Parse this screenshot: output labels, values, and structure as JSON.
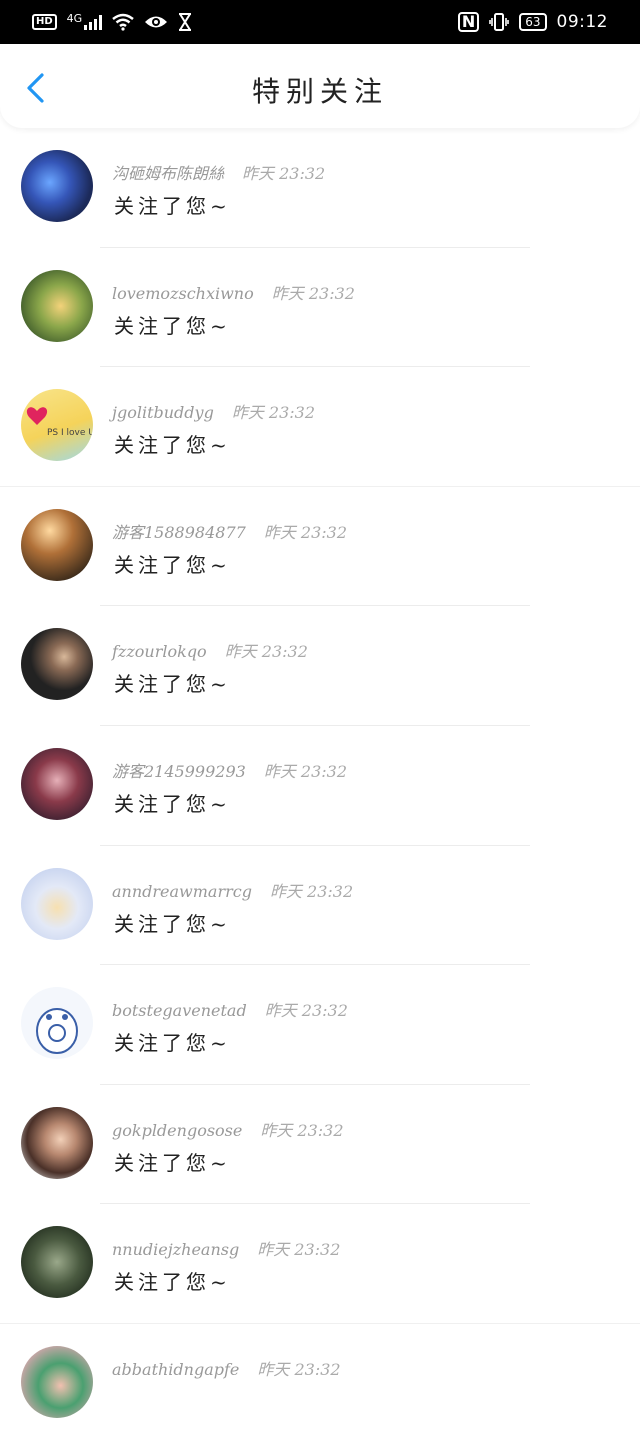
{
  "status_bar": {
    "hd": "HD",
    "network": "4G",
    "battery": "63",
    "time": "09:12"
  },
  "header": {
    "title": "特别关注"
  },
  "items": [
    {
      "name": "沟砸姆布陈朗絲",
      "time": "昨天 23:32",
      "message": "关注了您~",
      "avatar_color": "#2a3f8f"
    },
    {
      "name": "lovemozschxiwno",
      "time": "昨天 23:32",
      "message": "关注了您~",
      "avatar_color": "#6a8a2e"
    },
    {
      "name": "jgolitbuddyg",
      "time": "昨天 23:32",
      "message": "关注了您~",
      "avatar_color": "#f2d36b"
    },
    {
      "name": "游客1588984877",
      "time": "昨天 23:32",
      "message": "关注了您~",
      "avatar_color": "#8a5a2a"
    },
    {
      "name": "fzzourlokqo",
      "time": "昨天 23:32",
      "message": "关注了您~",
      "avatar_color": "#2b2b2b"
    },
    {
      "name": "游客2145999293",
      "time": "昨天 23:32",
      "message": "关注了您~",
      "avatar_color": "#6a3b4a"
    },
    {
      "name": "anndreawmarrcg",
      "time": "昨天 23:32",
      "message": "关注了您~",
      "avatar_color": "#c9d6f0"
    },
    {
      "name": "botstegavenetad",
      "time": "昨天 23:32",
      "message": "关注了您~",
      "avatar_color": "#e9eef8"
    },
    {
      "name": "gokpldengosose",
      "time": "昨天 23:32",
      "message": "关注了您~",
      "avatar_color": "#7a5a4a"
    },
    {
      "name": "nnudiejzheansg",
      "time": "昨天 23:32",
      "message": "关注了您~",
      "avatar_color": "#3c4a3a"
    },
    {
      "name": "abbathidngapfe",
      "time": "昨天 23:32",
      "message": "",
      "avatar_color": "#4a9a6a"
    }
  ]
}
